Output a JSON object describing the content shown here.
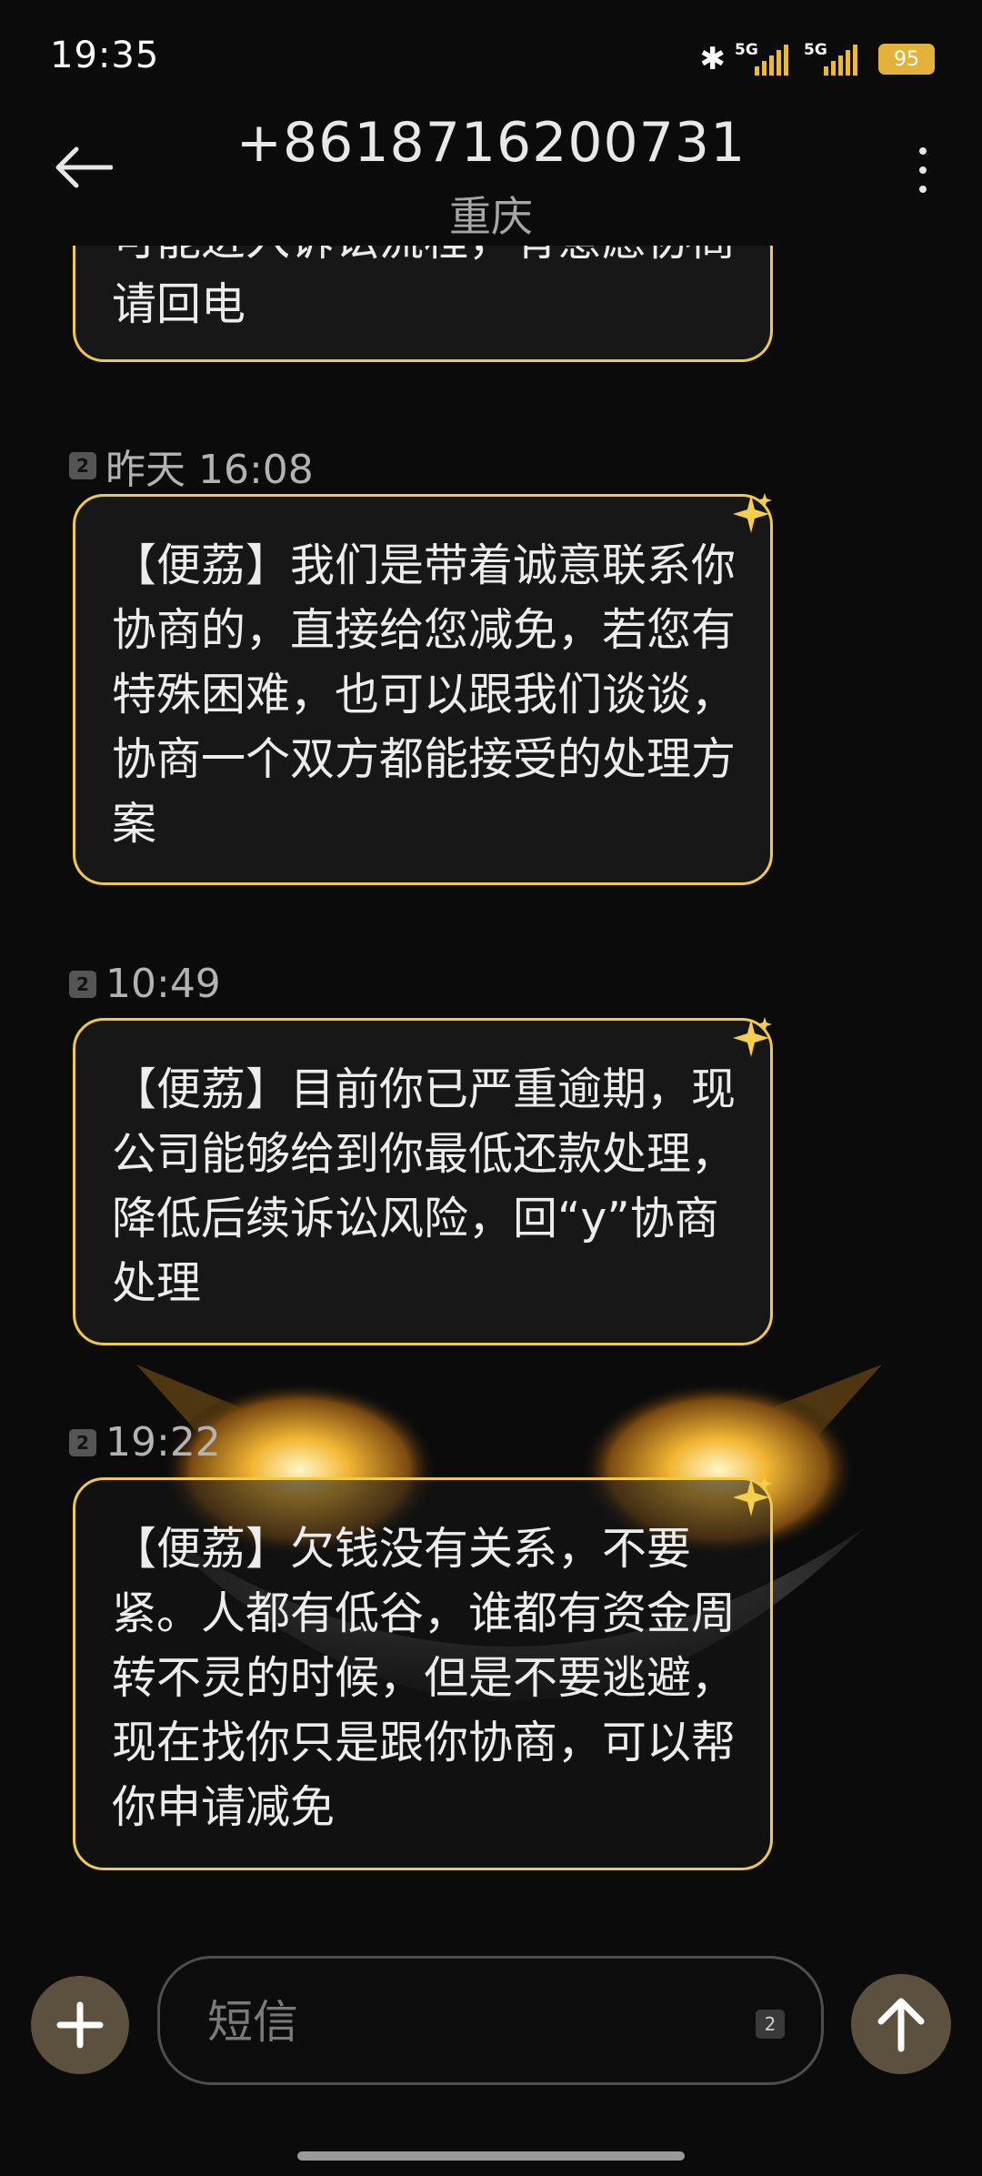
{
  "status_bar": {
    "time": "19:35",
    "battery": "95",
    "signal1": "5G",
    "signal2": "5G"
  },
  "header": {
    "contact_number": "+8618716200731",
    "location": "重庆"
  },
  "messages": [
    {
      "text": "可能进入诉讼流程，有意愿协商请回电"
    },
    {
      "sim": "2",
      "time": "昨天 16:08",
      "text": "【便荔】我们是带着诚意联系你协商的，直接给您减免，若您有特殊困难，也可以跟我们谈谈，协商一个双方都能接受的处理方案"
    },
    {
      "sim": "2",
      "time": "10:49",
      "text": "【便荔】目前你已严重逾期，现公司能够给到你最低还款处理，降低后续诉讼风险，回“y”协商处理"
    },
    {
      "sim": "2",
      "time": "19:22",
      "text": "【便荔】欠钱没有关系，不要紧。人都有低谷，谁都有资金周转不灵的时候，但是不要逃避，现在找你只是跟你协商，可以帮你申请减免"
    }
  ],
  "composer": {
    "placeholder": "短信",
    "sim": "2"
  },
  "colors": {
    "accent": "#f0c84a",
    "button": "#5b513e",
    "background": "#0b0b0b"
  }
}
